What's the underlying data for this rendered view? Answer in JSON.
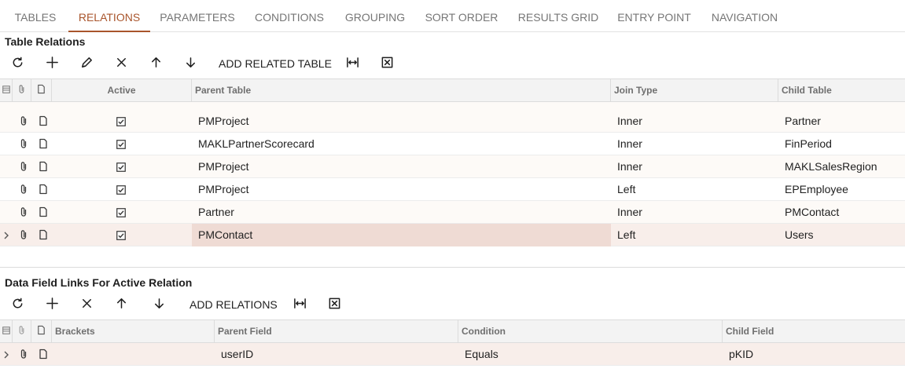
{
  "tabs": [
    {
      "label": "TABLES",
      "active": false
    },
    {
      "label": "RELATIONS",
      "active": true
    },
    {
      "label": "PARAMETERS",
      "active": false
    },
    {
      "label": "CONDITIONS",
      "active": false
    },
    {
      "label": "GROUPING",
      "active": false
    },
    {
      "label": "SORT ORDER",
      "active": false
    },
    {
      "label": "RESULTS GRID",
      "active": false
    },
    {
      "label": "ENTRY POINT",
      "active": false
    },
    {
      "label": "NAVIGATION",
      "active": false
    }
  ],
  "relations": {
    "title": "Table Relations",
    "toolbar": {
      "icons": [
        "refresh-icon",
        "add-icon",
        "edit-icon",
        "delete-icon",
        "move-up-icon",
        "move-down-icon"
      ],
      "add_related_table_label": "ADD RELATED TABLE",
      "fit_icon": "fit-columns-icon",
      "export_icon": "excel-export-icon"
    },
    "columns": {
      "active": "Active",
      "parent_table": "Parent Table",
      "join_type": "Join Type",
      "child_table": "Child Table"
    },
    "rows": [
      {
        "active": true,
        "parent_table": "PMProject",
        "join_type": "Inner",
        "child_table": "Partner",
        "selected": false
      },
      {
        "active": true,
        "parent_table": "MAKLPartnerScorecard",
        "join_type": "Inner",
        "child_table": "FinPeriod",
        "selected": false
      },
      {
        "active": true,
        "parent_table": "PMProject",
        "join_type": "Inner",
        "child_table": "MAKLSalesRegion",
        "selected": false
      },
      {
        "active": true,
        "parent_table": "PMProject",
        "join_type": "Left",
        "child_table": "EPEmployee",
        "selected": false
      },
      {
        "active": true,
        "parent_table": "Partner",
        "join_type": "Inner",
        "child_table": "PMContact",
        "selected": false
      },
      {
        "active": true,
        "parent_table": "PMContact",
        "join_type": "Left",
        "child_table": "Users",
        "selected": true
      }
    ]
  },
  "links": {
    "title": "Data Field Links For Active Relation",
    "toolbar": {
      "icons": [
        "refresh-icon",
        "add-icon",
        "delete-icon",
        "move-up-icon",
        "move-down-icon"
      ],
      "add_relations_label": "ADD RELATIONS",
      "fit_icon": "fit-columns-icon",
      "export_icon": "excel-export-icon"
    },
    "columns": {
      "brackets": "Brackets",
      "parent_field": "Parent Field",
      "condition": "Condition",
      "child_field": "Child Field"
    },
    "rows": [
      {
        "brackets": "",
        "parent_field": "userID",
        "condition": "Equals",
        "child_field": "pKID",
        "selected": true
      }
    ]
  },
  "colors": {
    "accent": "#a9552c",
    "selected_row": "#f8eeea",
    "selected_cell": "#efdbd4"
  }
}
